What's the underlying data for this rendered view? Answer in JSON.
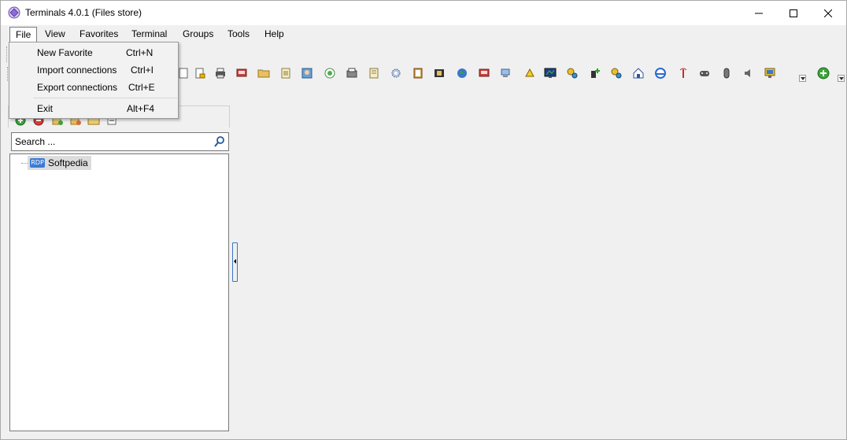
{
  "window": {
    "title": "Terminals 4.0.1 (Files store)"
  },
  "menubar": {
    "items": [
      {
        "label": "File"
      },
      {
        "label": "View"
      },
      {
        "label": "Favorites"
      },
      {
        "label": "Terminal"
      },
      {
        "label": "Groups"
      },
      {
        "label": "Tools"
      },
      {
        "label": "Help"
      }
    ]
  },
  "file_menu": {
    "items": [
      {
        "label": "New Favorite",
        "shortcut": "Ctrl+N"
      },
      {
        "label": "Import connections",
        "shortcut": "Ctrl+I"
      },
      {
        "label": "Export connections",
        "shortcut": "Ctrl+E"
      },
      {
        "label": "Exit",
        "shortcut": "Alt+F4"
      }
    ]
  },
  "search": {
    "placeholder": "Search ..."
  },
  "tree": {
    "items": [
      {
        "label": "Softpedia",
        "badge": "RDP"
      }
    ]
  },
  "colors": {
    "accent": "#3b74c2",
    "add_green": "#3aa53a",
    "remove_red": "#d83b3b"
  }
}
